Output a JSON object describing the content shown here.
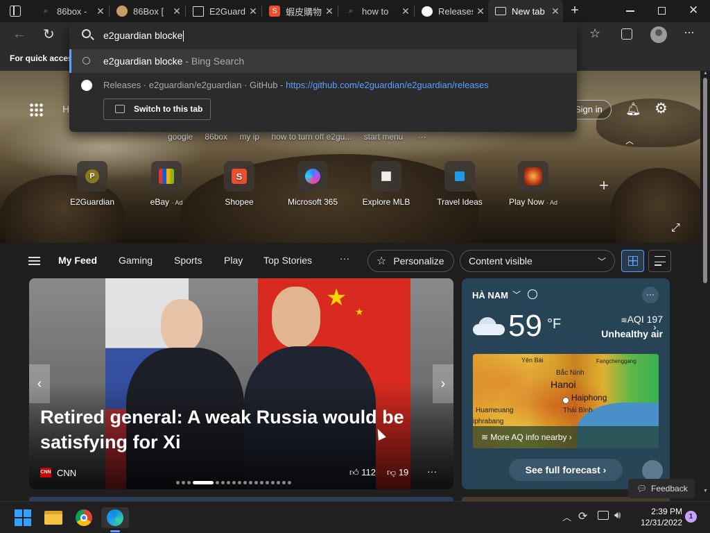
{
  "tabs": [
    {
      "title": "86box -",
      "icon": "search-icon"
    },
    {
      "title": "86Box [",
      "icon": "avatar-icon"
    },
    {
      "title": "E2Guard",
      "icon": "document-icon"
    },
    {
      "title": "蝦皮購物",
      "icon": "shopee-icon"
    },
    {
      "title": "how to",
      "icon": "search-icon"
    },
    {
      "title": "Releases",
      "icon": "github-icon"
    },
    {
      "title": "New tab",
      "icon": "newtab-icon",
      "active": true
    }
  ],
  "address": {
    "value": "e2guardian blocke"
  },
  "suggestions": {
    "search": {
      "query": "e2guardian blocke",
      "suffix": " - Bing Search"
    },
    "tab": {
      "title": "Releases · e2guardian/e2guardian · GitHub",
      "sep": " - ",
      "url": "https://github.com/e2guardian/e2guardian/releases",
      "button": "Switch to this tab"
    }
  },
  "favbar": {
    "text": "For quick access,"
  },
  "hero": {
    "h_letter": "H",
    "signin": "Sign in",
    "recent_searches": [
      "google",
      "86box",
      "my ip",
      "how to turn off e2gu...",
      "start menu"
    ],
    "quicklinks": [
      {
        "label": "E2Guardian",
        "glyph": "P",
        "ad": ""
      },
      {
        "label": "eBay",
        "glyph": "▥",
        "ad": "· Ad"
      },
      {
        "label": "Shopee",
        "glyph": "S",
        "ad": ""
      },
      {
        "label": "Microsoft 365",
        "glyph": "◆",
        "ad": ""
      },
      {
        "label": "Explore MLB",
        "glyph": "▫",
        "ad": ""
      },
      {
        "label": "Travel Ideas",
        "glyph": "■",
        "ad": ""
      },
      {
        "label": "Play Now",
        "glyph": "✷",
        "ad": "· Ad"
      }
    ]
  },
  "feed": {
    "nav": [
      "My Feed",
      "Gaming",
      "Sports",
      "Play",
      "Top Stories"
    ],
    "personalize": "Personalize",
    "content_visible": "Content visible"
  },
  "card": {
    "headline": "Retired general: A weak Russia would be satisfying for Xi",
    "source": "CNN",
    "likes": "112",
    "dislikes": "19"
  },
  "weather": {
    "location": "HÀ NAM",
    "temp": "59",
    "unit": "°F",
    "aqi": "AQI 197",
    "aqi_desc": "Unhealthy air",
    "map_labels": [
      "Yên Bái",
      "Fangchenggang",
      "Bắc Ninh",
      "Hanoi",
      "Haiphong",
      "Huameuang",
      "Thái Bình",
      "iphrabang"
    ],
    "more_aq": "More AQ info nearby",
    "forecast": "See full forecast"
  },
  "feedback": "Feedback",
  "clock": {
    "time": "2:39 PM",
    "date": "12/31/2022"
  },
  "notification_count": "1",
  "colors": {
    "accent": "#5aa0ff",
    "shopee": "#ee4d2d",
    "cnn": "#cc0000"
  }
}
